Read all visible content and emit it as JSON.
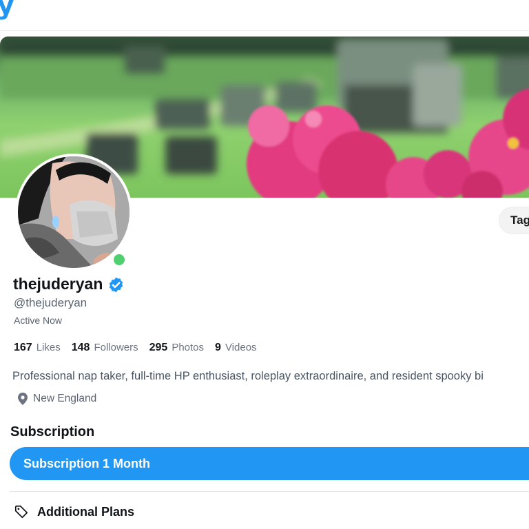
{
  "header": {
    "logo_fragment": "y"
  },
  "profile": {
    "display_name": "thejuderyan",
    "handle": "@thejuderyan",
    "status": "Active Now",
    "verified": true,
    "online": true,
    "bio": "Professional nap taker, full-time HP enthusiast, roleplay extraordinaire, and resident spooky bi",
    "location": "New England"
  },
  "stats": [
    {
      "value": "167",
      "label": "Likes"
    },
    {
      "value": "148",
      "label": "Followers"
    },
    {
      "value": "295",
      "label": "Photos"
    },
    {
      "value": "9",
      "label": "Videos"
    }
  ],
  "actions": {
    "tags_label": "Tag"
  },
  "subscription": {
    "heading": "Subscription",
    "button_label": "Subscription 1 Month",
    "additional_plans_label": "Additional Plans"
  },
  "icons": {
    "verified": "verified-badge-icon",
    "location": "map-pin-icon",
    "plans": "price-tag-icon"
  },
  "colors": {
    "accent": "#2196f3",
    "online": "#4fcf70"
  }
}
